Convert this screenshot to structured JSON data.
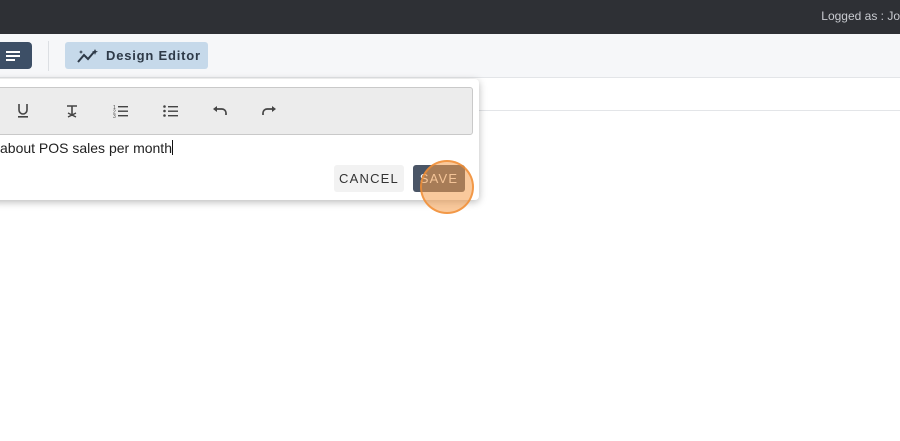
{
  "header": {
    "logged_as_text": "Logged as : Jo"
  },
  "toolbar": {
    "design_editor_label": "Design Editor"
  },
  "editor": {
    "text": "about POS sales per month",
    "tools": [
      "underline-icon",
      "clear-format-icon",
      "ordered-list-icon",
      "bullet-list-icon",
      "undo-icon",
      "redo-icon"
    ]
  },
  "actions": {
    "cancel_label": "CANCEL",
    "save_label": "SAVE"
  },
  "colors": {
    "topbar": "#2e3035",
    "accent_button": "#3d4f66",
    "design_editor_bg": "#c6d9ea",
    "save_button": "#4a5566",
    "click_indicator": "#f49c4a"
  }
}
